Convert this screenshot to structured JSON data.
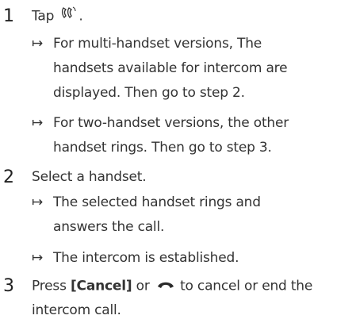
{
  "steps": [
    {
      "number": "1",
      "instruction_prefix": "Tap",
      "instruction_suffix": ".",
      "instruction_icon": "intercom-icon",
      "results": [
        {
          "lines": [
            "For multi-handset versions, The",
            "handsets available for intercom are",
            "displayed. Then go to step 2."
          ]
        },
        {
          "lines": [
            "For two-handset versions, the other",
            "handset rings. Then go to step 3."
          ]
        }
      ]
    },
    {
      "number": "2",
      "instruction": "Select a handset.",
      "results": [
        {
          "lines": [
            "The selected handset rings and",
            "answers the call."
          ]
        },
        {
          "lines": [
            "The intercom is established."
          ]
        }
      ]
    },
    {
      "number": "3",
      "instruction_prefix": "Press",
      "button_label": "[Cancel]",
      "instruction_middle": "or",
      "instruction_icon": "end-call-icon",
      "instruction_suffix": "to cancel or end the",
      "instruction_line2": "intercom call."
    }
  ],
  "arrow_glyph": "↦"
}
